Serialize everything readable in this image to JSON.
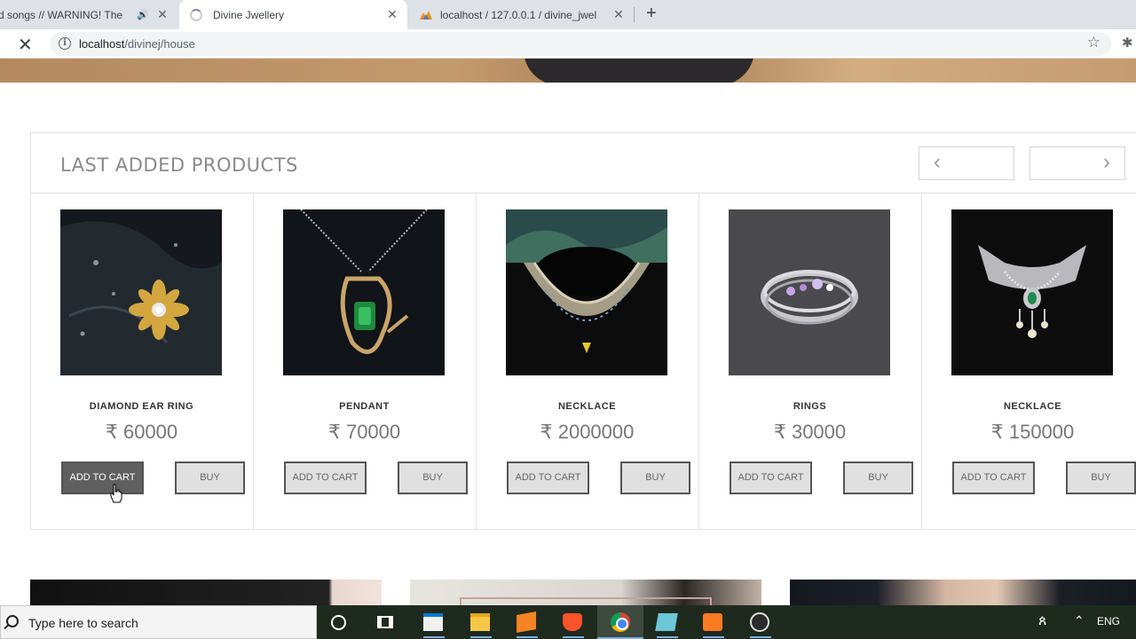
{
  "browser": {
    "tabs": [
      {
        "title": "d songs // WARNING! The"
      },
      {
        "title": "Divine Jwellery"
      },
      {
        "title": "localhost / 127.0.0.1 / divine_jwel"
      }
    ],
    "new_tab_symbol": "+",
    "close_symbol": "✕",
    "stop_symbol": "✕",
    "url_host": "localhost",
    "url_path": "/divinej/house",
    "star_symbol": "☆",
    "extensions_symbol": "✱"
  },
  "section": {
    "title": "LAST ADDED PRODUCTS",
    "prev_symbol": "‹",
    "next_symbol": "›"
  },
  "products": [
    {
      "name": "DIAMOND EAR RING",
      "price": "₹ 60000",
      "cart_label": "ADD TO CART",
      "buy_label": "BUY"
    },
    {
      "name": "PENDANT",
      "price": "₹ 70000",
      "cart_label": "ADD TO CART",
      "buy_label": "BUY"
    },
    {
      "name": "NECKLACE",
      "price": "₹ 2000000",
      "cart_label": "ADD TO CART",
      "buy_label": "BUY"
    },
    {
      "name": "RINGS",
      "price": "₹ 30000",
      "cart_label": "ADD TO CART",
      "buy_label": "BUY"
    },
    {
      "name": "NECKLACE",
      "price": "₹ 150000",
      "cart_label": "ADD TO CART",
      "buy_label": "BUY"
    }
  ],
  "taskbar": {
    "search_placeholder": "Type here to search",
    "language": "ENG",
    "tray_people_symbol": "ጰ",
    "tray_caret_symbol": "⌃"
  },
  "colors": {
    "accent_button": "#5f5f5f",
    "taskbar": "#1f2a1f"
  }
}
